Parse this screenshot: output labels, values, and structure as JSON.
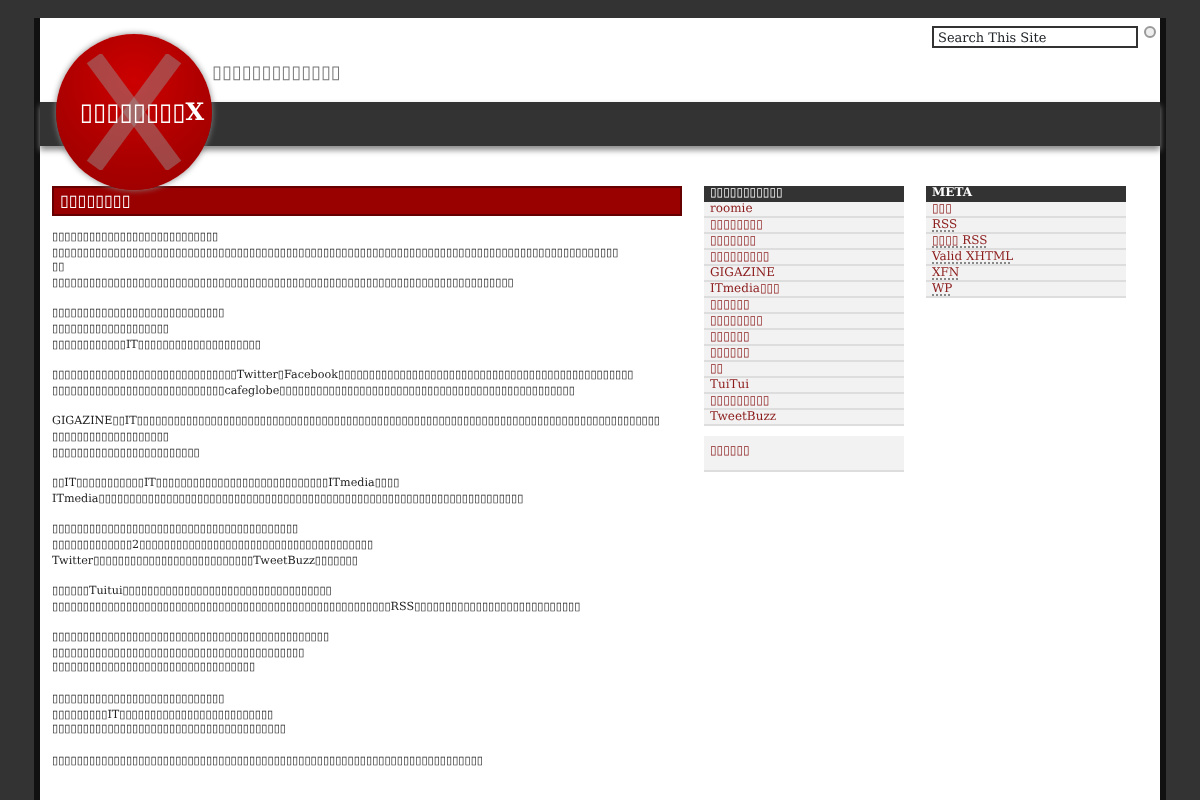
{
  "header": {
    "logo_text": "▯▯▯▯▯▯▯▯X",
    "tagline": "▯▯▯▯▯▯▯▯▯▯▯▯▯",
    "search": {
      "value": "Search This Site"
    }
  },
  "post": {
    "title": "▯▯▯▯▯▯▯▯",
    "paragraphs": [
      [
        "▯▯▯▯▯▯▯▯▯▯▯▯▯▯▯▯▯▯▯▯▯▯▯▯▯▯▯",
        "▯▯▯▯▯▯▯▯▯▯▯▯▯▯▯▯▯▯▯▯▯▯▯▯▯▯▯▯▯▯▯▯▯▯▯▯▯▯▯▯▯▯▯▯▯▯▯▯▯▯▯▯▯▯▯▯▯▯▯▯▯▯▯▯▯▯▯▯▯▯▯▯▯▯▯▯▯▯▯▯▯▯▯▯▯▯▯▯▯▯▯▯",
        "▯▯",
        "▯▯▯▯▯▯▯▯▯▯▯▯▯▯▯▯▯▯▯▯▯▯▯▯▯▯▯▯▯▯▯▯▯▯▯▯▯▯▯▯▯▯▯▯▯▯▯▯▯▯▯▯▯▯▯▯▯▯▯▯▯▯▯▯▯▯▯▯▯▯▯▯▯▯▯"
      ],
      [
        "▯▯▯▯▯▯▯▯▯▯▯▯▯▯▯▯▯▯▯▯▯▯▯▯▯▯▯▯",
        "▯▯▯▯▯▯▯▯▯▯▯▯▯▯▯▯▯▯▯",
        "▯▯▯▯▯▯▯▯▯▯▯▯IT▯▯▯▯▯▯▯▯▯▯▯▯▯▯▯▯▯▯▯▯"
      ],
      [
        "▯▯▯▯▯▯▯▯▯▯▯▯▯▯▯▯▯▯▯▯▯▯▯▯▯▯▯▯▯▯Twitter▯Facebook▯▯▯▯▯▯▯▯▯▯▯▯▯▯▯▯▯▯▯▯▯▯▯▯▯▯▯▯▯▯▯▯▯▯▯▯▯▯▯▯▯▯▯▯▯▯▯▯",
        "▯▯▯▯▯▯▯▯▯▯▯▯▯▯▯▯▯▯▯▯▯▯▯▯▯▯▯▯cafeglobe▯▯▯▯▯▯▯▯▯▯▯▯▯▯▯▯▯▯▯▯▯▯▯▯▯▯▯▯▯▯▯▯▯▯▯▯▯▯▯▯▯▯▯▯▯▯▯▯"
      ],
      [
        "GIGAZINE▯▯IT▯▯▯▯▯▯▯▯▯▯▯▯▯▯▯▯▯▯▯▯▯▯▯▯▯▯▯▯▯▯▯▯▯▯▯▯▯▯▯▯▯▯▯▯▯▯▯▯▯▯▯▯▯▯▯▯▯▯▯▯▯▯▯▯▯▯▯▯▯▯▯▯▯▯▯▯▯▯▯▯▯▯▯▯▯",
        "▯▯▯▯▯▯▯▯▯▯▯▯▯▯▯▯▯▯▯",
        "▯▯▯▯▯▯▯▯▯▯▯▯▯▯▯▯▯▯▯▯▯▯▯▯"
      ],
      [
        "▯▯IT▯▯▯▯▯▯▯▯▯▯▯IT▯▯▯▯▯▯▯▯▯▯▯▯▯▯▯▯▯▯▯▯▯▯▯▯▯▯▯▯ITmedia▯▯▯▯",
        "ITmedia▯▯▯▯▯▯▯▯▯▯▯▯▯▯▯▯▯▯▯▯▯▯▯▯▯▯▯▯▯▯▯▯▯▯▯▯▯▯▯▯▯▯▯▯▯▯▯▯▯▯▯▯▯▯▯▯▯▯▯▯▯▯▯▯▯▯▯▯▯"
      ],
      [
        "▯▯▯▯▯▯▯▯▯▯▯▯▯▯▯▯▯▯▯▯▯▯▯▯▯▯▯▯▯▯▯▯▯▯▯▯▯▯▯▯",
        "▯▯▯▯▯▯▯▯▯▯▯▯▯2▯▯▯▯▯▯▯▯▯▯▯▯▯▯▯▯▯▯▯▯▯▯▯▯▯▯▯▯▯▯▯▯▯▯▯▯▯▯",
        "Twitter▯▯▯▯▯▯▯▯▯▯▯▯▯▯▯▯▯▯▯▯▯▯▯▯▯▯TweetBuzz▯▯▯▯▯▯▯"
      ],
      [
        "▯▯▯▯▯▯Tuitui▯▯▯▯▯▯▯▯▯▯▯▯▯▯▯▯▯▯▯▯▯▯▯▯▯▯▯▯▯▯▯▯▯▯",
        "▯▯▯▯▯▯▯▯▯▯▯▯▯▯▯▯▯▯▯▯▯▯▯▯▯▯▯▯▯▯▯▯▯▯▯▯▯▯▯▯▯▯▯▯▯▯▯▯▯▯▯▯▯▯▯RSS▯▯▯▯▯▯▯▯▯▯▯▯▯▯▯▯▯▯▯▯▯▯▯▯▯▯▯"
      ],
      [
        "▯▯▯▯▯▯▯▯▯▯▯▯▯▯▯▯▯▯▯▯▯▯▯▯▯▯▯▯▯▯▯▯▯▯▯▯▯▯▯▯▯▯▯▯▯",
        "▯▯▯▯▯▯▯▯▯▯▯▯▯▯▯▯▯▯▯▯▯▯▯▯▯▯▯▯▯▯▯▯▯▯▯▯▯▯▯▯▯",
        "▯▯▯▯▯▯▯▯▯▯▯▯▯▯▯▯▯▯▯▯▯▯▯▯▯▯▯▯▯▯▯▯▯"
      ],
      [
        "▯▯▯▯▯▯▯▯▯▯▯▯▯▯▯▯▯▯▯▯▯▯▯▯▯▯▯▯",
        "▯▯▯▯▯▯▯▯▯IT▯▯▯▯▯▯▯▯▯▯▯▯▯▯▯▯▯▯▯▯▯▯▯▯▯",
        "▯▯▯▯▯▯▯▯▯▯▯▯▯▯▯▯▯▯▯▯▯▯▯▯▯▯▯▯▯▯▯▯▯▯▯▯▯▯"
      ],
      [
        "▯▯▯▯▯▯▯▯▯▯▯▯▯▯▯▯▯▯▯▯▯▯▯▯▯▯▯▯▯▯▯▯▯▯▯▯▯▯▯▯▯▯▯▯▯▯▯▯▯▯▯▯▯▯▯▯▯▯▯▯▯▯▯▯▯▯▯▯▯▯"
      ]
    ]
  },
  "sidebar": {
    "title": "▯▯▯▯▯▯▯▯▯▯▯",
    "links": [
      {
        "label": "roomie"
      },
      {
        "label": "▯▯▯▯▯▯▯▯"
      },
      {
        "label": "▯▯▯▯▯▯▯"
      },
      {
        "label": "▯▯▯▯▯▯▯▯▯"
      },
      {
        "label": "GIGAZINE"
      },
      {
        "label": "ITmedia▯▯▯"
      },
      {
        "label": "▯▯▯▯▯▯"
      },
      {
        "label": "▯▯▯▯▯▯▯▯"
      },
      {
        "label": "▯▯▯▯▯▯"
      },
      {
        "label": "▯▯▯▯▯▯"
      },
      {
        "label": "▯▯"
      },
      {
        "label": "TuiTui"
      },
      {
        "label": "▯▯▯▯▯▯▯▯▯"
      },
      {
        "label": "TweetBuzz"
      }
    ],
    "extra_link": "▯▯▯▯▯▯"
  },
  "meta": {
    "title": "META",
    "links": [
      {
        "label": "▯▯▯",
        "abbr": false
      },
      {
        "label": "RSS",
        "abbr": true
      },
      {
        "label": "▯▯▯▯ RSS",
        "abbr": true
      },
      {
        "label": "Valid XHTML",
        "abbr": true
      },
      {
        "label": "XFN",
        "abbr": true
      },
      {
        "label": "WP",
        "abbr": true
      }
    ]
  }
}
